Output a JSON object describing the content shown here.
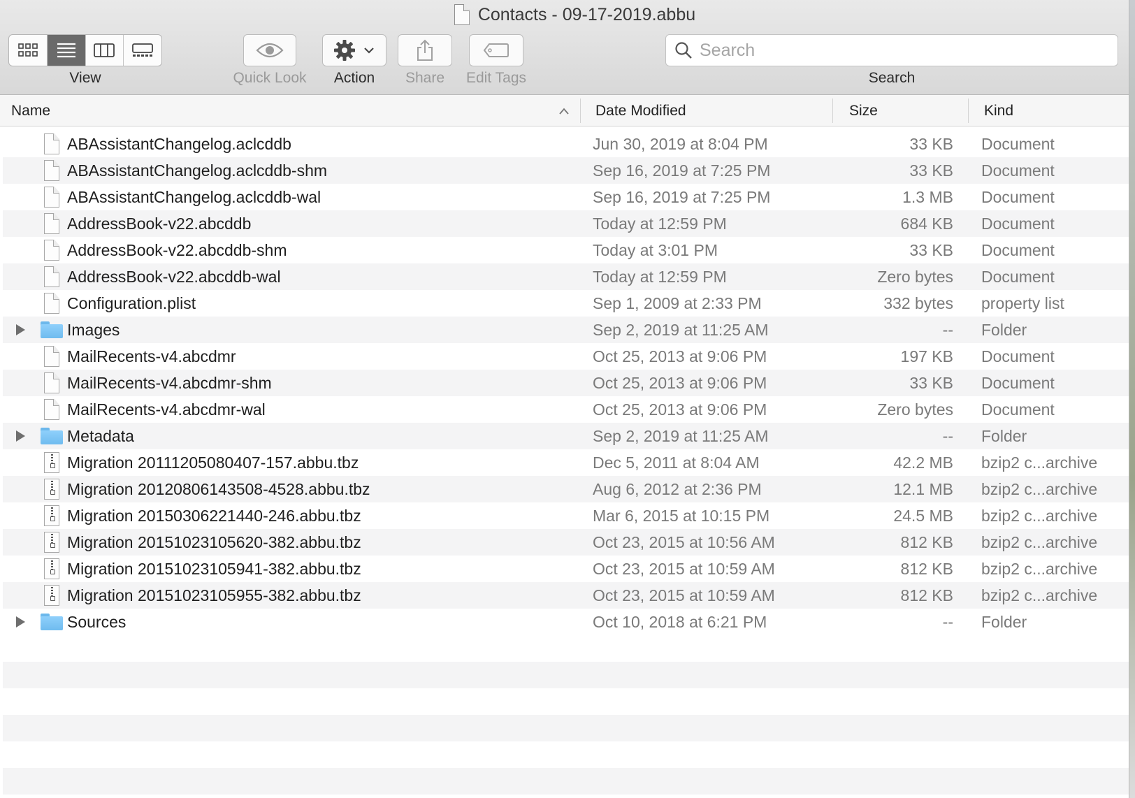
{
  "window": {
    "title": "Contacts - 09-17-2019.abbu"
  },
  "toolbar": {
    "view_label": "View",
    "view_modes": [
      {
        "name": "icon-view",
        "icon": "grid-icon"
      },
      {
        "name": "list-view",
        "icon": "list-icon",
        "active": true
      },
      {
        "name": "column-view",
        "icon": "columns-icon"
      },
      {
        "name": "gallery-view",
        "icon": "gallery-icon"
      }
    ],
    "quick_look_label": "Quick Look",
    "action_label": "Action",
    "share_label": "Share",
    "edit_tags_label": "Edit Tags",
    "search_label": "Search",
    "search_placeholder": "Search"
  },
  "columns": {
    "name": "Name",
    "date_modified": "Date Modified",
    "size": "Size",
    "kind": "Kind",
    "sort": "name-ascending"
  },
  "files": [
    {
      "name": "ABAssistantChangelog.aclcddb",
      "date": "Jun 30, 2019 at 8:04 PM",
      "size": "33 KB",
      "kind": "Document",
      "type": "doc"
    },
    {
      "name": "ABAssistantChangelog.aclcddb-shm",
      "date": "Sep 16, 2019 at 7:25 PM",
      "size": "33 KB",
      "kind": "Document",
      "type": "doc"
    },
    {
      "name": "ABAssistantChangelog.aclcddb-wal",
      "date": "Sep 16, 2019 at 7:25 PM",
      "size": "1.3 MB",
      "kind": "Document",
      "type": "doc"
    },
    {
      "name": "AddressBook-v22.abcddb",
      "date": "Today at 12:59 PM",
      "size": "684 KB",
      "kind": "Document",
      "type": "doc"
    },
    {
      "name": "AddressBook-v22.abcddb-shm",
      "date": "Today at 3:01 PM",
      "size": "33 KB",
      "kind": "Document",
      "type": "doc"
    },
    {
      "name": "AddressBook-v22.abcddb-wal",
      "date": "Today at 12:59 PM",
      "size": "Zero bytes",
      "kind": "Document",
      "type": "doc"
    },
    {
      "name": "Configuration.plist",
      "date": "Sep 1, 2009 at 2:33 PM",
      "size": "332 bytes",
      "kind": "property list",
      "type": "doc"
    },
    {
      "name": "Images",
      "date": "Sep 2, 2019 at 11:25 AM",
      "size": "--",
      "kind": "Folder",
      "type": "folder"
    },
    {
      "name": "MailRecents-v4.abcdmr",
      "date": "Oct 25, 2013 at 9:06 PM",
      "size": "197 KB",
      "kind": "Document",
      "type": "doc"
    },
    {
      "name": "MailRecents-v4.abcdmr-shm",
      "date": "Oct 25, 2013 at 9:06 PM",
      "size": "33 KB",
      "kind": "Document",
      "type": "doc"
    },
    {
      "name": "MailRecents-v4.abcdmr-wal",
      "date": "Oct 25, 2013 at 9:06 PM",
      "size": "Zero bytes",
      "kind": "Document",
      "type": "doc"
    },
    {
      "name": "Metadata",
      "date": "Sep 2, 2019 at 11:25 AM",
      "size": "--",
      "kind": "Folder",
      "type": "folder"
    },
    {
      "name": "Migration 20111205080407-157.abbu.tbz",
      "date": "Dec 5, 2011 at 8:04 AM",
      "size": "42.2 MB",
      "kind": "bzip2 c...archive",
      "type": "zip"
    },
    {
      "name": "Migration 20120806143508-4528.abbu.tbz",
      "date": "Aug 6, 2012 at 2:36 PM",
      "size": "12.1 MB",
      "kind": "bzip2 c...archive",
      "type": "zip"
    },
    {
      "name": "Migration 20150306221440-246.abbu.tbz",
      "date": "Mar 6, 2015 at 10:15 PM",
      "size": "24.5 MB",
      "kind": "bzip2 c...archive",
      "type": "zip"
    },
    {
      "name": "Migration 20151023105620-382.abbu.tbz",
      "date": "Oct 23, 2015 at 10:56 AM",
      "size": "812 KB",
      "kind": "bzip2 c...archive",
      "type": "zip"
    },
    {
      "name": "Migration 20151023105941-382.abbu.tbz",
      "date": "Oct 23, 2015 at 10:59 AM",
      "size": "812 KB",
      "kind": "bzip2 c...archive",
      "type": "zip"
    },
    {
      "name": "Migration 20151023105955-382.abbu.tbz",
      "date": "Oct 23, 2015 at 10:59 AM",
      "size": "812 KB",
      "kind": "bzip2 c...archive",
      "type": "zip"
    },
    {
      "name": "Sources",
      "date": "Oct 10, 2018 at 6:21 PM",
      "size": "--",
      "kind": "Folder",
      "type": "folder"
    }
  ],
  "colors": {
    "folder": "#7cc4f4",
    "selected_segment": "#6a6a6a",
    "row_alt": "#f4f4f5",
    "secondary_text": "#7a7a7a"
  }
}
